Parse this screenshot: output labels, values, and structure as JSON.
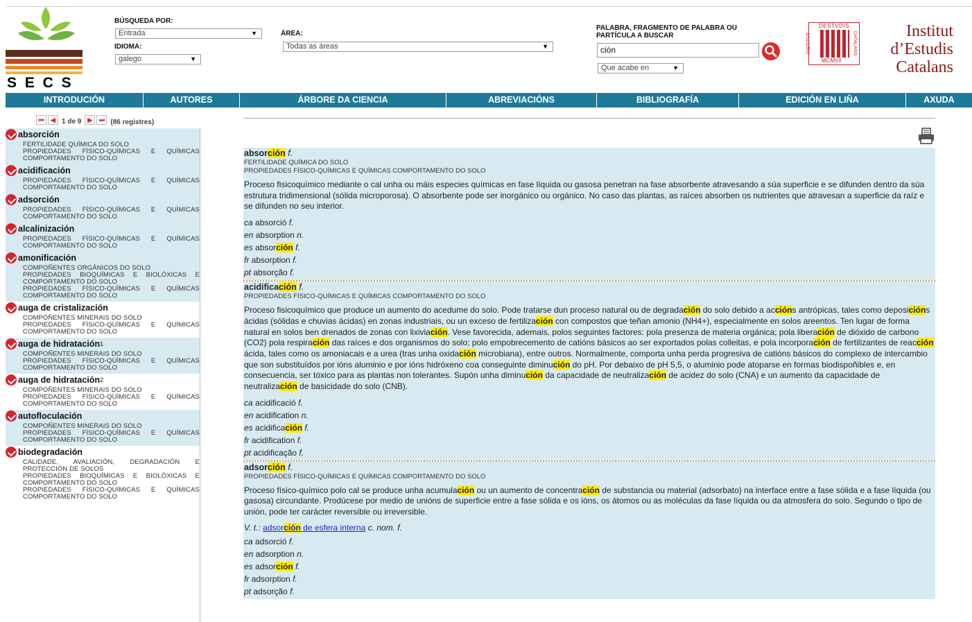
{
  "logo": {
    "text": "S E C S"
  },
  "search": {
    "busqueda_label": "BÚSQUEDA POR:",
    "busqueda_value": "Entrada",
    "idioma_label": "IDIOMA:",
    "idioma_value": "galego",
    "area_label": "ÁREA:",
    "area_value": "Todas as áreas",
    "palabra_label_1": "PALABRA, FRAGMENTO DE PALABRA OU",
    "palabra_label_2": "PARTÍCULA A BUSCAR",
    "palabra_value": "ción",
    "mode_value": "Que acabe en"
  },
  "iec": {
    "line1": "Institut",
    "line2": "d’Estudis",
    "line3": "Catalans",
    "seal_top": "DESTVDIS",
    "seal_bottom": "MCMVII",
    "seal_left": "INSTITVT",
    "seal_right": "CATALANS"
  },
  "menu": [
    "INTRODUCIÓN",
    "AUTORES",
    "ÁRBORE DA CIENCIA",
    "ABREVIACIÓNS",
    "BIBLIOGRAFÍA",
    "EDICIÓN EN LIÑA",
    "AXUDA"
  ],
  "pager": {
    "page": "1 de 9",
    "count": "(86 registres)"
  },
  "list": [
    {
      "term": "absorción",
      "areas": [
        "FERTILIDADE QUÍMICA DO SOLO",
        "PROPIEDADES FÍSICO-QUÍMICAS E QUÍMICAS COMPORTAMENTO DO SOLO"
      ],
      "shade": true
    },
    {
      "term": "acidificación",
      "areas": [
        "PROPIEDADES FÍSICO-QUÍMICAS E QUÍMICAS COMPORTAMENTO DO SOLO"
      ],
      "shade": true
    },
    {
      "term": "adsorción",
      "areas": [
        "PROPIEDADES FÍSICO-QUÍMICAS E QUÍMICAS COMPORTAMENTO DO SOLO"
      ],
      "shade": true
    },
    {
      "term": "alcalinización",
      "areas": [
        "PROPIEDADES FÍSICO-QUÍMICAS E QUÍMICAS COMPORTAMENTO DO SOLO"
      ],
      "shade": true
    },
    {
      "term": "amonificación",
      "areas": [
        "COMPOÑENTES ORGÁNICOS DO SOLO",
        "PROPIEDADES BIOQUÍMICAS E BIOLÓXICAS E COMPORTAMENTO DO SOLO",
        "PROPIEDADES FÍSICO-QUÍMICAS E QUÍMICAS COMPORTAMENTO DO SOLO"
      ],
      "shade": true
    },
    {
      "term": "auga de cristalización",
      "areas": [
        "COMPOÑENTES MINERAIS DO SOLO",
        "PROPIEDADES FÍSICO-QUÍMICAS E QUÍMICAS COMPORTAMENTO DO SOLO"
      ],
      "shade": false
    },
    {
      "term": "auga de hidratación",
      "sup": "1",
      "areas": [
        "COMPOÑENTES MINERAIS DO SOLO",
        "PROPIEDADES FÍSICO-QUÍMICAS E QUÍMICAS COMPORTAMENTO DO SOLO"
      ],
      "shade": true
    },
    {
      "term": "auga de hidratación",
      "sup": "2",
      "areas": [
        "COMPOÑENTES MINERAIS DO SOLO",
        "PROPIEDADES FÍSICO-QUÍMICAS E QUÍMICAS COMPORTAMENTO DO SOLO"
      ],
      "shade": false
    },
    {
      "term": "autofloculación",
      "areas": [
        "COMPOÑENTES MINERAIS DO SOLO",
        "PROPIEDADES FÍSICO-QUÍMICAS E QUÍMICAS COMPORTAMENTO DO SOLO"
      ],
      "shade": true
    },
    {
      "term": "biodegradación",
      "areas": [
        "CALIDADE, AVALIACIÓN, DEGRADACIÓN E PROTECCIÓN DE SOLOS",
        "PROPIEDADES BIOQUÍMICAS E BIOLÓXICAS E COMPORTAMENTO DO SOLO",
        "PROPIEDADES FÍSICO-QUÍMICAS E QUÍMICAS COMPORTAMENTO DO SOLO"
      ],
      "shade": false
    }
  ],
  "entries": [
    {
      "term_pre": "absor",
      "term_hl": "ción",
      "gram": "f.",
      "areas": [
        "FERTILIDADE QUÍMICA DO SOLO",
        "PROPIEDADES FÍSICO-QUÍMICAS E QUÍMICAS COMPORTAMENTO DO SOLO"
      ],
      "def": "Proceso fisicoquímico mediante o cal unha ou máis especies químicas en fase líquida ou gasosa penetran na fase absorbente atravesando a súa superficie e se difunden dentro da súa estrutura tridimensional (sólida microporosa). O absorbente pode ser inorgánico ou orgánico. No caso das plantas, as raíces absorben os nutrientes que atravesan a superficie da raíz e se difunden no seu interior.",
      "eq": [
        {
          "l": "ca",
          "w": "absorció",
          "g": "f."
        },
        {
          "l": "en",
          "w": "absorption",
          "g": "n."
        },
        {
          "l": "es",
          "w": "absor",
          "h": "ción",
          "g": "f."
        },
        {
          "l": "fr",
          "w": "absorption",
          "g": "f."
        },
        {
          "l": "pt",
          "w": "absorção",
          "g": "f."
        }
      ]
    },
    {
      "term_pre": "acidifica",
      "term_hl": "ción",
      "gram": "f.",
      "areas": [
        "PROPIEDADES FÍSICO-QUÍMICAS E QUÍMICAS COMPORTAMENTO DO SOLO"
      ],
      "def": "Proceso fisicoquímico que produce un aumento do acedume do solo. Pode tratarse dun proceso natural ou de degradación do solo debido a accións antrópicas, tales como deposicións ácidas (sólidas e chuvias ácidas) en zonas industriais, ou un exceso de fertilización con compostos que teñan amonio (NH4+), especialmente en solos areentos. Ten lugar de forma natural en solos ben drenados de zonas con lixiviación. Vese favorecida, ademais, polos seguintes factores: pola presenza de materia orgánica; pola liberación de dióxido de carbono (CO2) pola respiración das raíces e dos organismos do solo; polo empobrecemento de catións básicos ao ser exportados polas colleitas, e pola incorporación de fertilizantes de reacción ácida, tales como os amoniacais e a urea (tras unha oxidación microbiana), entre outros. Normalmente, comporta unha perda progresiva de catións básicos do complexo de intercambio que son substituídos por ións aluminio e por ións hidróxeno coa conseguinte diminución do pH. Por debaixo de pH 5,5, o aluminio pode atoparse en formas biodispoñibles e, en consecuencia, ser tóxico para as plantas non tolerantes. Supón unha diminución da capacidade de neutralización de acidez do solo (CNA) e un aumento da capacidade de neutralización de basicidade do solo (CNB).",
      "eq": [
        {
          "l": "ca",
          "w": "acidificació",
          "g": "f."
        },
        {
          "l": "en",
          "w": "acidification",
          "g": "n."
        },
        {
          "l": "es",
          "w": "acidifica",
          "h": "ción",
          "g": "f."
        },
        {
          "l": "fr",
          "w": "acidification",
          "g": "f."
        },
        {
          "l": "pt",
          "w": "acidificação",
          "g": "f."
        }
      ]
    },
    {
      "term_pre": "adsor",
      "term_hl": "ción",
      "gram": "f.",
      "areas": [
        "PROPIEDADES FÍSICO-QUÍMICAS E QUÍMICAS COMPORTAMENTO DO SOLO"
      ],
      "def": "Proceso físico-químico polo cal se produce unha acumulación ou un aumento de concentración de substancia ou material (adsorbato) na interface entre a fase sólida e a fase líquida (ou gasosa) circundante. Prodúcese por medio de unións de superficie entre a fase sólida e os ións, os átomos ou as moléculas da fase líquida ou da atmosfera do solo. Segundo o tipo de unión, pode ter carácter reversible ou irreversible.",
      "vt": {
        "label": "V. t.:",
        "link": "adsorción de esfera interna",
        "gram": "c. nom. f."
      },
      "eq": [
        {
          "l": "ca",
          "w": "adsorció",
          "g": "f."
        },
        {
          "l": "en",
          "w": "adsorption",
          "g": "n."
        },
        {
          "l": "es",
          "w": "adsor",
          "h": "ción",
          "g": "f."
        },
        {
          "l": "fr",
          "w": "adsorption",
          "g": "f."
        },
        {
          "l": "pt",
          "w": "adsorção",
          "g": "f."
        }
      ]
    }
  ],
  "colors": {
    "menu": "#1f7a99",
    "shade": "#d8eaf1",
    "highlight": "#ffec00",
    "accent": "#d8232a"
  }
}
